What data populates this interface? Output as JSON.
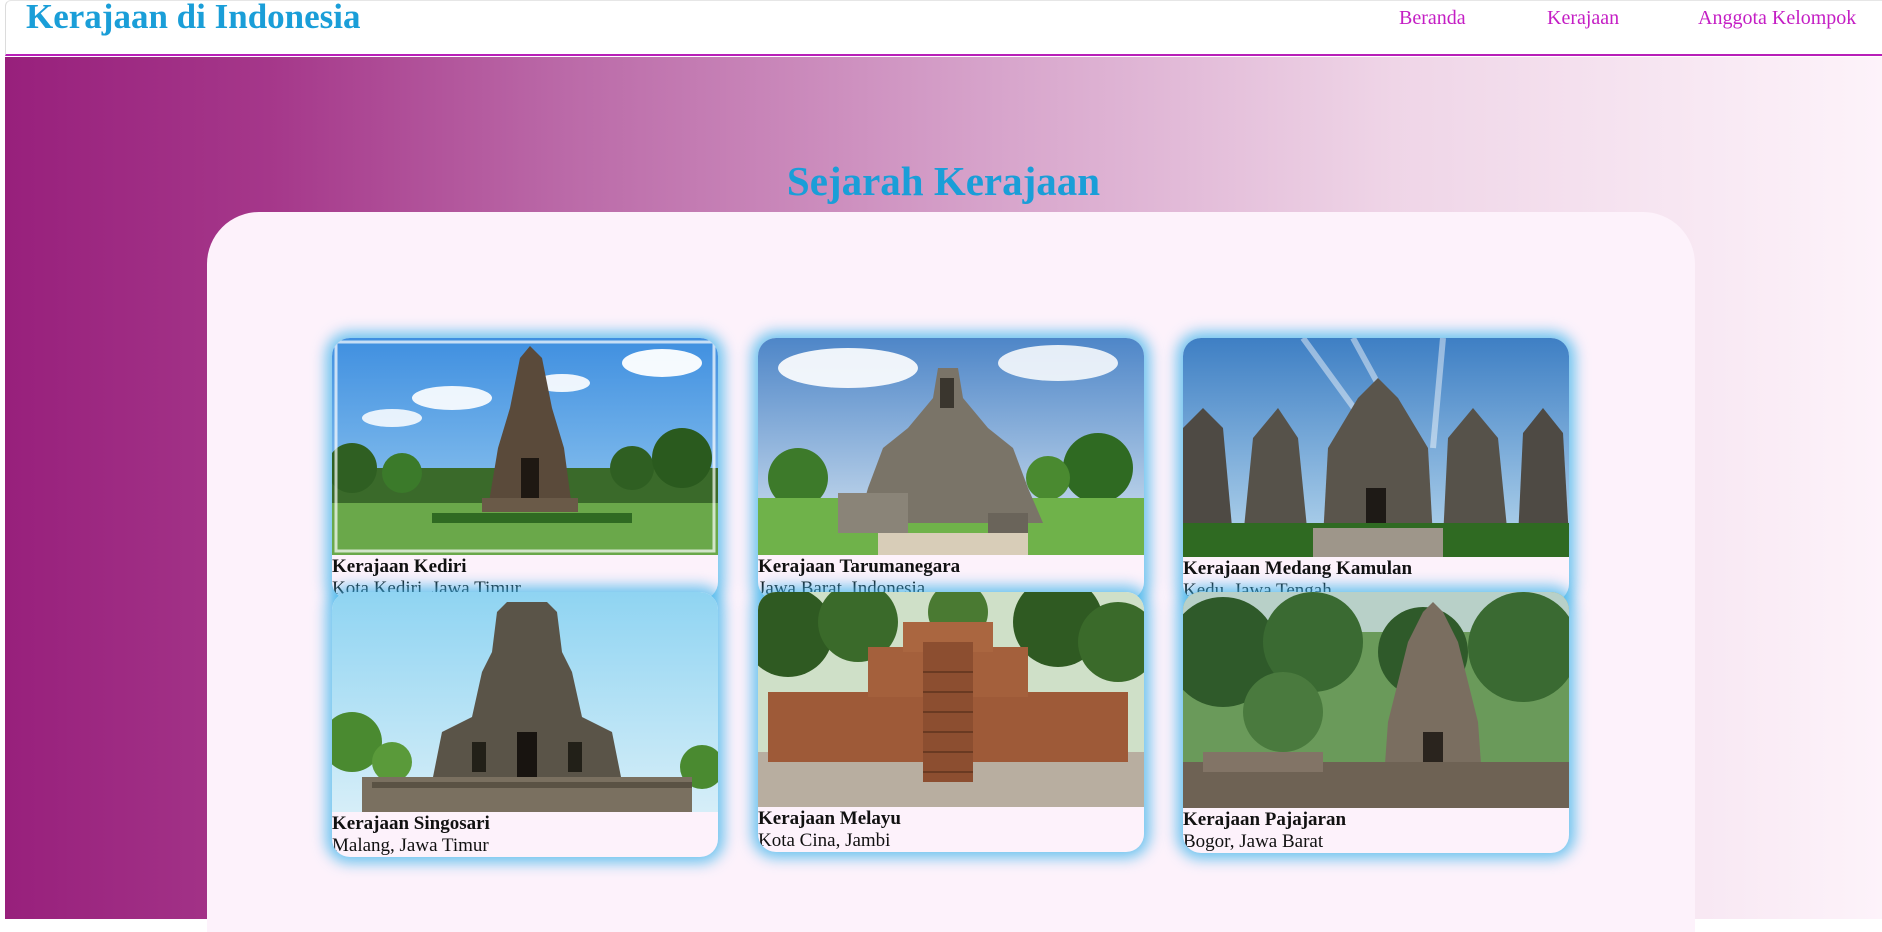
{
  "header": {
    "brand": "Kerajaan di Indonesia",
    "nav": [
      {
        "label": "Beranda"
      },
      {
        "label": "Kerajaan"
      },
      {
        "label": "Anggota Kelompok"
      }
    ]
  },
  "main": {
    "title": "Sejarah Kerajaan",
    "cards": [
      {
        "title": "Kerajaan Kediri",
        "location": "Kota Kediri, Jawa Timur"
      },
      {
        "title": "Kerajaan Tarumanegara",
        "location": "Jawa Barat, Indonesia"
      },
      {
        "title": "Kerajaan Medang Kamulan",
        "location": "Kedu, Jawa Tengah"
      },
      {
        "title": "Kerajaan Singosari",
        "location": "Malang, Jawa Timur"
      },
      {
        "title": "Kerajaan Melayu",
        "location": "Kota Cina, Jambi"
      },
      {
        "title": "Kerajaan Pajajaran",
        "location": "Bogor, Jawa Barat"
      }
    ]
  },
  "colors": {
    "accent_blue": "#1a9ed8",
    "nav_magenta": "#c41ec4",
    "gradient_start": "#98207c",
    "card_glow": "#3cb4eb"
  }
}
